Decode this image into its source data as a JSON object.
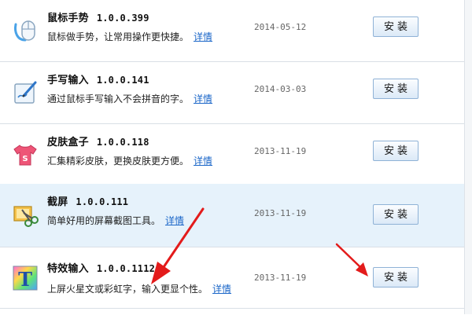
{
  "install_label": "安装",
  "detail_label": "详情",
  "plugins": [
    {
      "name": "鼠标手势",
      "version": "1.0.0.399",
      "description": "鼠标做手势，让常用操作更快捷。",
      "date": "2014-05-12",
      "icon": "mouse-gesture-icon"
    },
    {
      "name": "手写输入",
      "version": "1.0.0.141",
      "description": "通过鼠标手写输入不会拼音的字。",
      "date": "2014-03-03",
      "icon": "handwriting-pen-icon"
    },
    {
      "name": "皮肤盒子",
      "version": "1.0.0.118",
      "description": "汇集精彩皮肤，更换皮肤更方便。",
      "date": "2013-11-19",
      "icon": "skin-shirt-icon"
    },
    {
      "name": "截屏",
      "version": "1.0.0.111",
      "description": "简单好用的屏幕截图工具。",
      "date": "2013-11-19",
      "icon": "screenshot-scissors-icon"
    },
    {
      "name": "特效输入",
      "version": "1.0.0.1112",
      "description": "上屏火星文或彩虹字，输入更显个性。",
      "date": "2013-11-19",
      "icon": "special-text-T-icon"
    }
  ],
  "colors": {
    "highlight_row": "#e6f2fb",
    "link": "#1a66c8",
    "arrow": "#e31b1b"
  }
}
